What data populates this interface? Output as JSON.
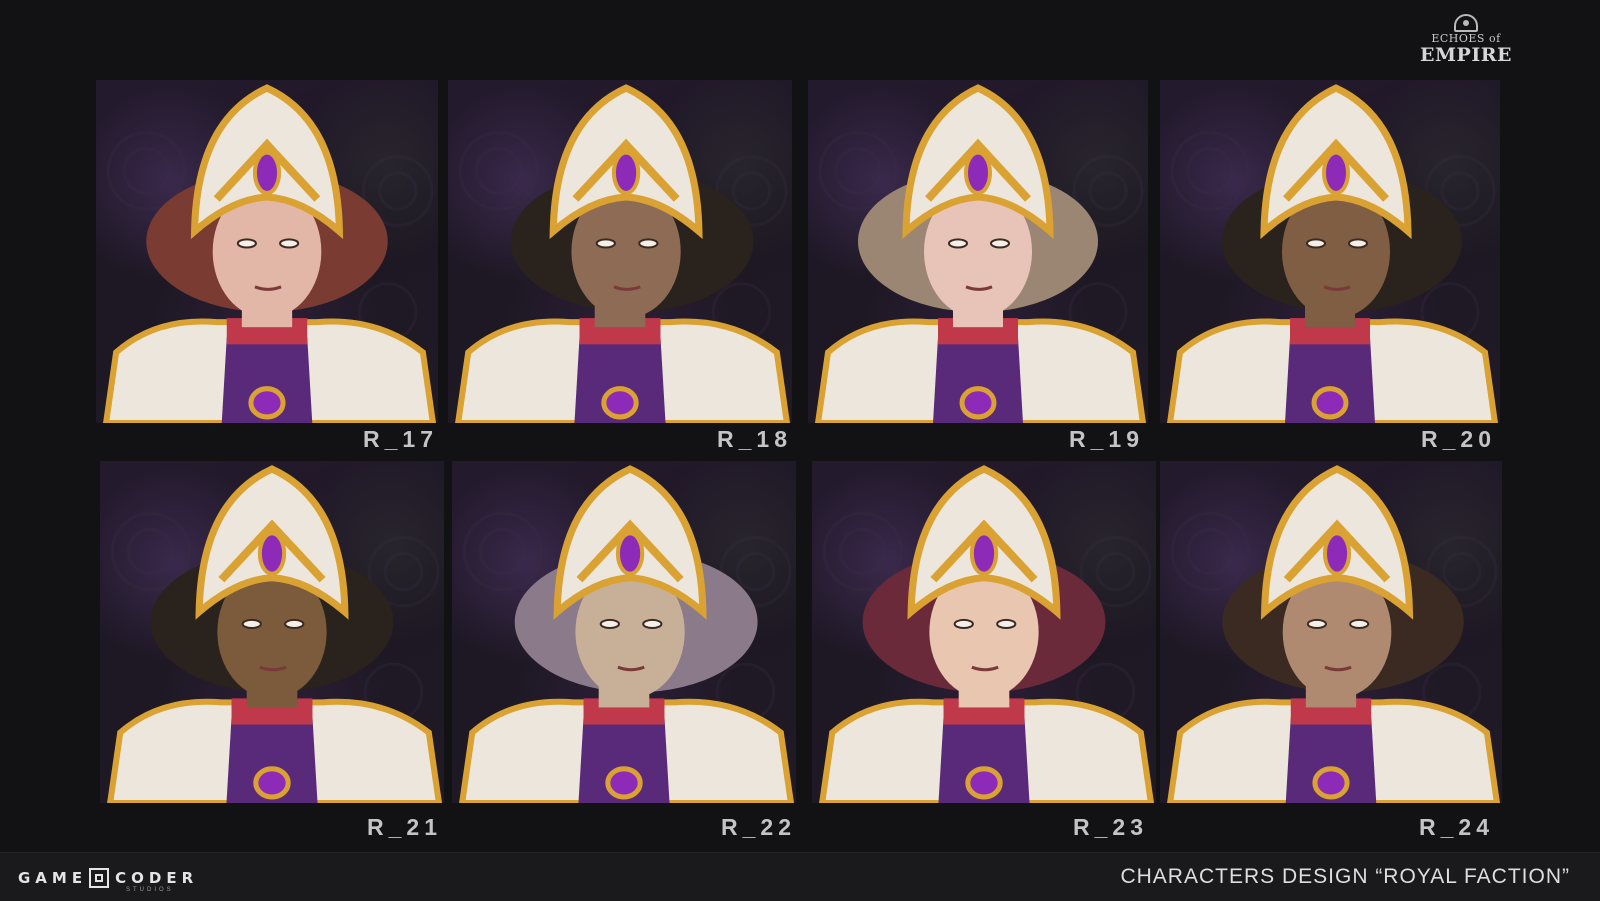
{
  "brand": {
    "game_logo_line1": "ECHOES of",
    "game_logo_line2": "EMPIRE",
    "studio_word1": "GAME",
    "studio_word2": "CODER",
    "studio_sub": "STUDIOS"
  },
  "title": "CHARACTERS DESIGN “ROYAL FACTION”",
  "portraits": [
    {
      "label": "R_17",
      "skin": "#e2b7a7",
      "hair": "#7a3c32",
      "gem": "#8d2bb8"
    },
    {
      "label": "R_18",
      "skin": "#8e6b55",
      "hair": "#2a221c",
      "gem": "#8d2bb8"
    },
    {
      "label": "R_19",
      "skin": "#e8c4b8",
      "hair": "#9a8672",
      "gem": "#8d2bb8"
    },
    {
      "label": "R_20",
      "skin": "#7f5e44",
      "hair": "#2a221c",
      "gem": "#8d2bb8"
    },
    {
      "label": "R_21",
      "skin": "#7c5a3c",
      "hair": "#2a221c",
      "gem": "#8d2bb8"
    },
    {
      "label": "R_22",
      "skin": "#c8b098",
      "hair": "#8a7a8a",
      "gem": "#8d2bb8"
    },
    {
      "label": "R_23",
      "skin": "#e8c6b0",
      "hair": "#6a2a3a",
      "gem": "#8d2bb8"
    },
    {
      "label": "R_24",
      "skin": "#b08a70",
      "hair": "#3a2a22",
      "gem": "#8d2bb8"
    }
  ],
  "colors": {
    "armor_white": "#ece6dc",
    "armor_gold": "#d9a232",
    "collar_red": "#c0394a",
    "undersuit_purple": "#5a2a7a",
    "background": "#121214",
    "footer": "#1a1a1d"
  }
}
